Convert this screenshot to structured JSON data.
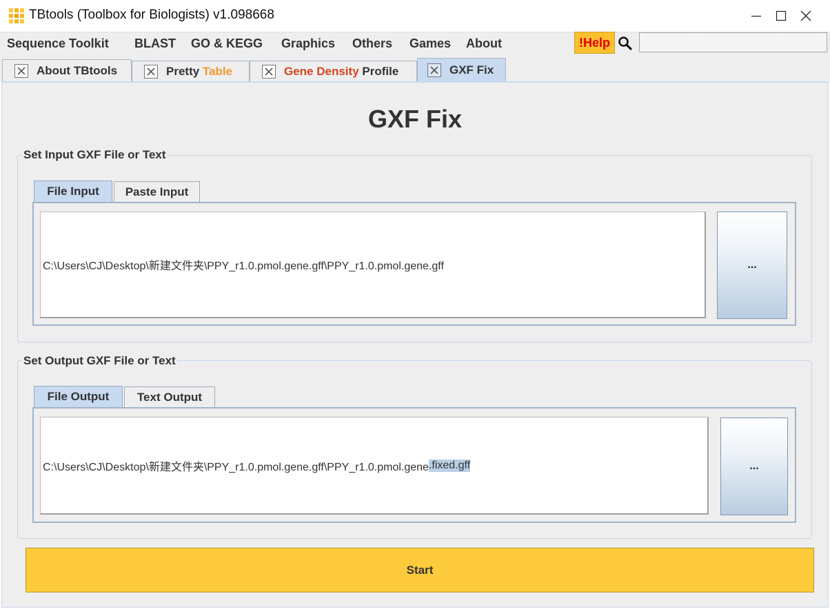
{
  "window": {
    "title": "TBtools (Toolbox for Biologists) v1.098668",
    "logo_colors": [
      "#f9c846",
      "#f3b522",
      "#f9c846",
      "#f3b522",
      "#e9a214",
      "#f3b522",
      "#f9c846",
      "#f3b522",
      "#f9c846"
    ]
  },
  "menu": {
    "items": [
      "Sequence Toolkit",
      "BLAST",
      "GO & KEGG",
      "Graphics",
      "Others",
      "Games",
      "About"
    ],
    "help_label": "!Help",
    "search_placeholder": ""
  },
  "doc_tabs": {
    "about": {
      "label": "About TBtools"
    },
    "pretty": {
      "label_a": "Pretty",
      "label_b": "Table"
    },
    "density": {
      "label_a": "Gene Density",
      "label_b": "Profile"
    },
    "gxf": {
      "label": "GXF Fix"
    }
  },
  "page": {
    "title": "GXF Fix"
  },
  "input_group": {
    "legend": "Set Input GXF File or Text",
    "tabs": [
      "File Input",
      "Paste Input"
    ],
    "path": "C:\\Users\\CJ\\Desktop\\新建文件夹\\PPY_r1.0.pmol.gene.gff\\PPY_r1.0.pmol.gene.gff",
    "browse_label": "..."
  },
  "output_group": {
    "legend": "Set Output GXF File or Text",
    "tabs": [
      "File Output",
      "Text Output"
    ],
    "path_prefix": "C:\\Users\\CJ\\Desktop\\新建文件夹\\PPY_r1.0.pmol.gene.gff\\PPY_r1.0.pmol.gene",
    "path_selected": ".fixed.gff",
    "browse_label": "..."
  },
  "actions": {
    "start_label": "Start"
  },
  "colors": {
    "accent_yellow": "#fecb3c",
    "help_text": "#e00000",
    "table_orange": "#f29a2e",
    "density_red": "#d2461f",
    "active_tab": "#c8daf0"
  }
}
